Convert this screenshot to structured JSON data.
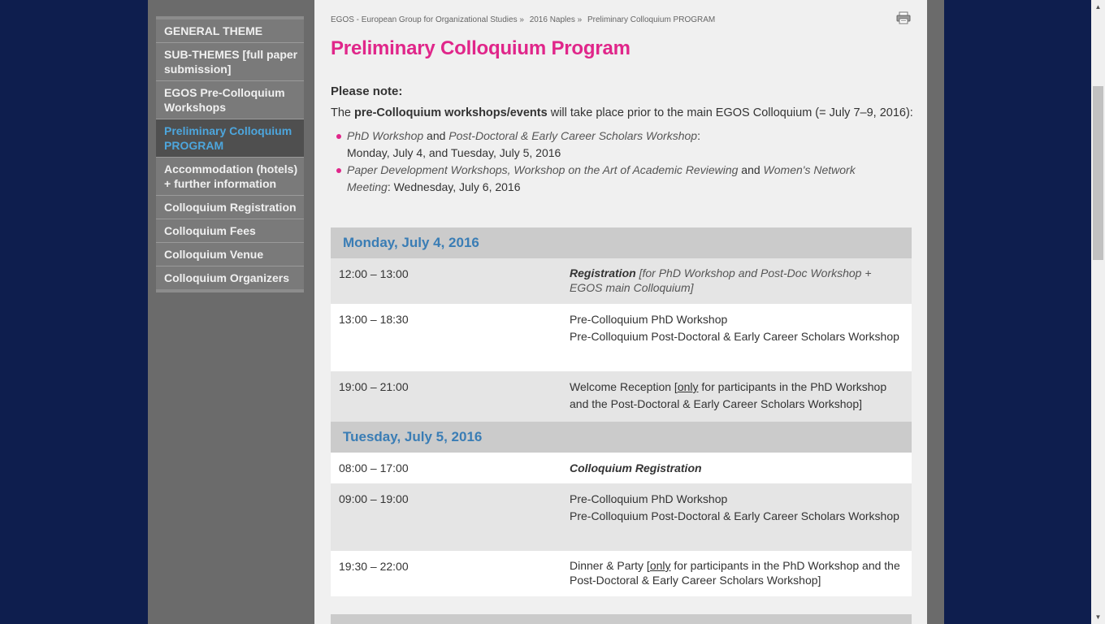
{
  "sidebar": {
    "items": [
      {
        "label": "GENERAL THEME"
      },
      {
        "label": "SUB-THEMES [full paper submission]"
      },
      {
        "label": "EGOS Pre-Colloquium Workshops"
      },
      {
        "label": "Preliminary Colloquium PROGRAM",
        "active": true
      },
      {
        "label": "Accommodation (hotels) + further information"
      },
      {
        "label": "Colloquium Registration"
      },
      {
        "label": "Colloquium Fees"
      },
      {
        "label": "Colloquium Venue"
      },
      {
        "label": "Colloquium Organizers"
      }
    ]
  },
  "breadcrumb": {
    "items": [
      "EGOS - European Group for Organizational Studies »",
      "2016 Naples »",
      "Preliminary Colloquium PROGRAM"
    ]
  },
  "icons": {
    "print": "print-icon"
  },
  "page": {
    "title": "Preliminary Colloquium Program",
    "note_heading": "Please note:",
    "intro": {
      "pre": "The ",
      "bold": "pre-Colloquium workshops/events",
      "post": " will take place prior to the main EGOS Colloquium (= July 7–9, 2016):"
    },
    "bullets": [
      {
        "it1": "PhD Workshop",
        "t1": " and ",
        "it2": "Post-Doctoral & Early Career Scholars Workshop",
        "t2": ":",
        "line2": "Monday, July 4, and Tuesday, July 5, 2016"
      },
      {
        "it1": "Paper Development Workshops, Workshop on the Art of Academic Reviewing",
        "t1": " and ",
        "it2": "Women's Network Meeting",
        "t2": ": Wednesday, July 6, 2016"
      }
    ]
  },
  "schedule": {
    "monday": {
      "title": "Monday, July 4, 2016",
      "rows": [
        {
          "time": "12:00 – 13:00",
          "bold": "Registration",
          "italic": " [for PhD Workshop and Post-Doc Workshop + EGOS main Colloquium]"
        },
        {
          "time": "13:00 – 18:30",
          "line1": "Pre-Colloquium PhD Workshop",
          "line2": "Pre-Colloquium Post-Doctoral & Early Career Scholars Workshop"
        },
        {
          "time": "19:00 – 21:00",
          "pre": "Welcome Reception [",
          "u": "only",
          "post": " for participants in the PhD Workshop and the Post-Doctoral & Early Career Scholars Workshop]"
        }
      ]
    },
    "tuesday": {
      "title": "Tuesday, July 5, 2016",
      "rows": [
        {
          "time": "08:00 – 17:00",
          "bold": "Colloquium Registration"
        },
        {
          "time": "09:00 – 19:00",
          "line1": "Pre-Colloquium PhD Workshop",
          "line2": "Pre-Colloquium Post-Doctoral & Early Career Scholars Workshop"
        },
        {
          "time": "19:30 – 22:00",
          "pre": "Dinner & Party [",
          "u": "only",
          "post": " for participants in the PhD Workshop and the Post-Doctoral & Early Career Scholars Workshop]"
        }
      ]
    }
  },
  "colors": {
    "background": "#0e1e4e",
    "title_pink": "#e0268a",
    "day_blue": "#3a7db5",
    "sidebar_active_text": "#4da6dd"
  }
}
